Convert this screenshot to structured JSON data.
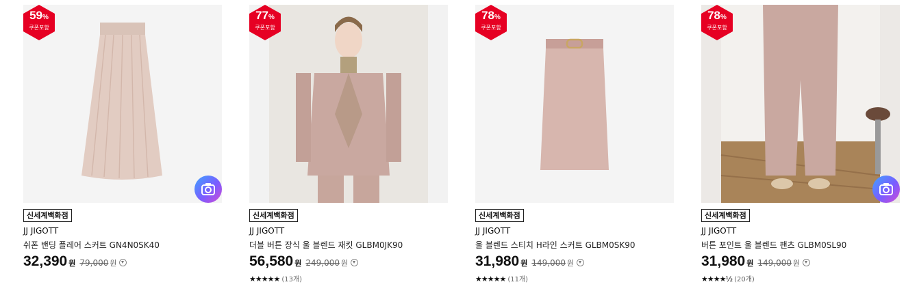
{
  "products": [
    {
      "badge_pct": "59",
      "badge_unit": "%",
      "badge_label": "쿠폰포함",
      "store": "신세계백화점",
      "brand": "JJ JIGOTT",
      "name": "쉬폰 밴딩 플레어 스커트 GN4N0SK40",
      "price": "32,390",
      "price_unit": "원",
      "orig_price": "79,000",
      "orig_unit": "원",
      "stars": "",
      "review_count": "",
      "has_camera": true
    },
    {
      "badge_pct": "77",
      "badge_unit": "%",
      "badge_label": "쿠폰포함",
      "store": "신세계백화점",
      "brand": "JJ JIGOTT",
      "name": "더블 버튼 장식 울 블렌드 재킷 GLBM0JK90",
      "price": "56,580",
      "price_unit": "원",
      "orig_price": "249,000",
      "orig_unit": "원",
      "stars": "★★★★★",
      "review_count": "(13개)",
      "has_camera": false
    },
    {
      "badge_pct": "78",
      "badge_unit": "%",
      "badge_label": "쿠폰포함",
      "store": "신세계백화점",
      "brand": "JJ JIGOTT",
      "name": "울 블렌드 스티치 H라인 스커트 GLBM0SK90",
      "price": "31,980",
      "price_unit": "원",
      "orig_price": "149,000",
      "orig_unit": "원",
      "stars": "★★★★★",
      "review_count": "(11개)",
      "has_camera": false
    },
    {
      "badge_pct": "78",
      "badge_unit": "%",
      "badge_label": "쿠폰포함",
      "store": "신세계백화점",
      "brand": "JJ JIGOTT",
      "name": "버튼 포인트 울 블렌드 팬츠 GLBM0SL90",
      "price": "31,980",
      "price_unit": "원",
      "orig_price": "149,000",
      "orig_unit": "원",
      "stars": "★★★★½",
      "review_count": "(20개)",
      "has_camera": true
    }
  ],
  "colors": {
    "badge": "#e60023",
    "product_tone": "#c9a8a0"
  },
  "icons": {
    "camera": "camera-icon",
    "price_info": "chevron-down-circle-icon"
  }
}
